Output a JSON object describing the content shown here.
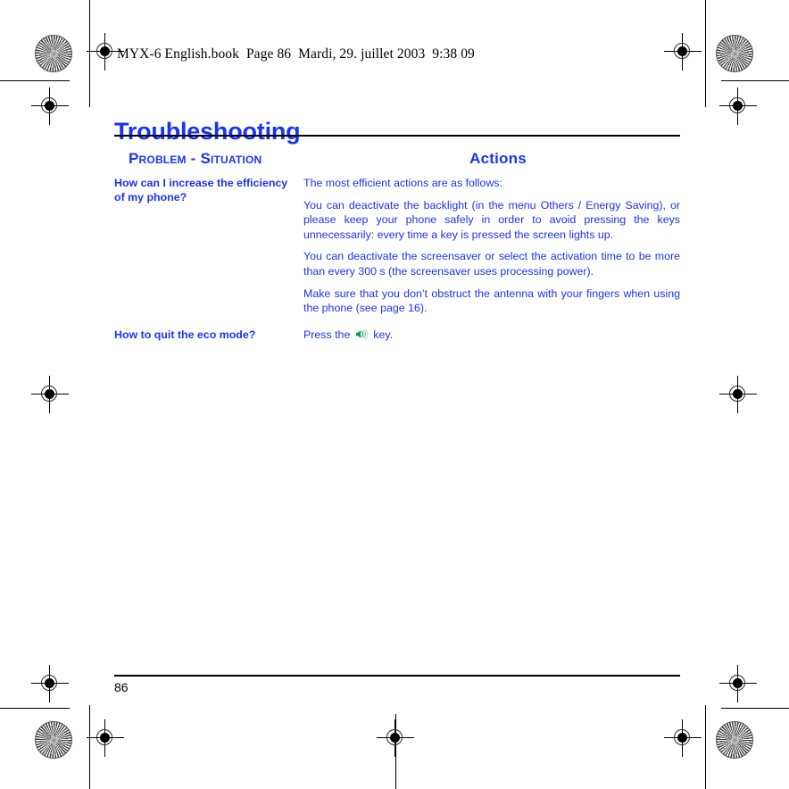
{
  "document": {
    "file_header": "MYX-6 English.book  Page 86  Mardi, 29. juillet 2003  9:38 09",
    "chapter_title": "Troubleshooting",
    "page_number": "86",
    "accent_color": "#1a33f2",
    "icon_color": "#00a04a",
    "rule_color": "#000000"
  },
  "table": {
    "headers": {
      "problem": "Problem - Situation",
      "actions": "Actions"
    },
    "rows": [
      {
        "question": "How can I increase the efficiency of my phone?",
        "answers": [
          "The most efficient actions are as follows:",
          "You can deactivate the backlight (in the menu Others / Energy Saving), or please keep your phone safely in order to avoid pressing the keys unnecessarily: every time a key is pressed the screen lights up.",
          "You can deactivate the screensaver or select the activation time to be more than every 300 s (the screensaver uses processing power).",
          "Make sure that you don’t obstruct the antenna with your fingers when using the phone (see page 16)."
        ]
      },
      {
        "question": "How to quit the eco mode?",
        "answer_prefix": "Press the",
        "answer_icon": "speaker-volume-icon",
        "answer_suffix": "key."
      }
    ]
  }
}
